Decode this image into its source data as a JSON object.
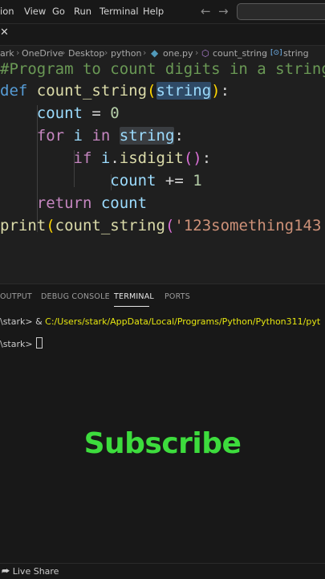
{
  "menu": {
    "items": [
      "ion",
      "View",
      "Go",
      "Run",
      "Terminal",
      "Help"
    ]
  },
  "nav": {
    "back": "←",
    "forward": "→"
  },
  "tab": {
    "close": "✕"
  },
  "breadcrumb": {
    "items": [
      "ark",
      "OneDrive",
      "Desktop",
      "python",
      "one.py",
      "count_string",
      "string"
    ],
    "separator": "›"
  },
  "editor": {
    "lines": [
      "#Program to count digits in a string",
      "def count_string(string):",
      "    count = 0",
      "    for i in string:",
      "        if i.isdigit():",
      "            count += 1",
      "    return count",
      "print(count_string('123something143"
    ]
  },
  "panel": {
    "tabs": [
      "OUTPUT",
      "DEBUG CONSOLE",
      "TERMINAL",
      "PORTS"
    ],
    "active_tab": "TERMINAL",
    "terminal": {
      "line1_prompt": "\\stark> & ",
      "line1_path": "C:/Users/stark/AppData/Local/Programs/Python/Python311/pyt",
      "line2_prompt": "\\stark> "
    },
    "overlay": "Subscribe"
  },
  "status": {
    "liveshare": "Live Share"
  },
  "colors": {
    "background": "#1f1f1f",
    "keyword": "#c586c0",
    "def_keyword": "#569cd6",
    "function": "#dcdcaa",
    "variable": "#9cdcfe",
    "number": "#b5cea8",
    "string": "#ce9178",
    "comment": "#6a9955",
    "subscribe": "#3ddc3d"
  }
}
